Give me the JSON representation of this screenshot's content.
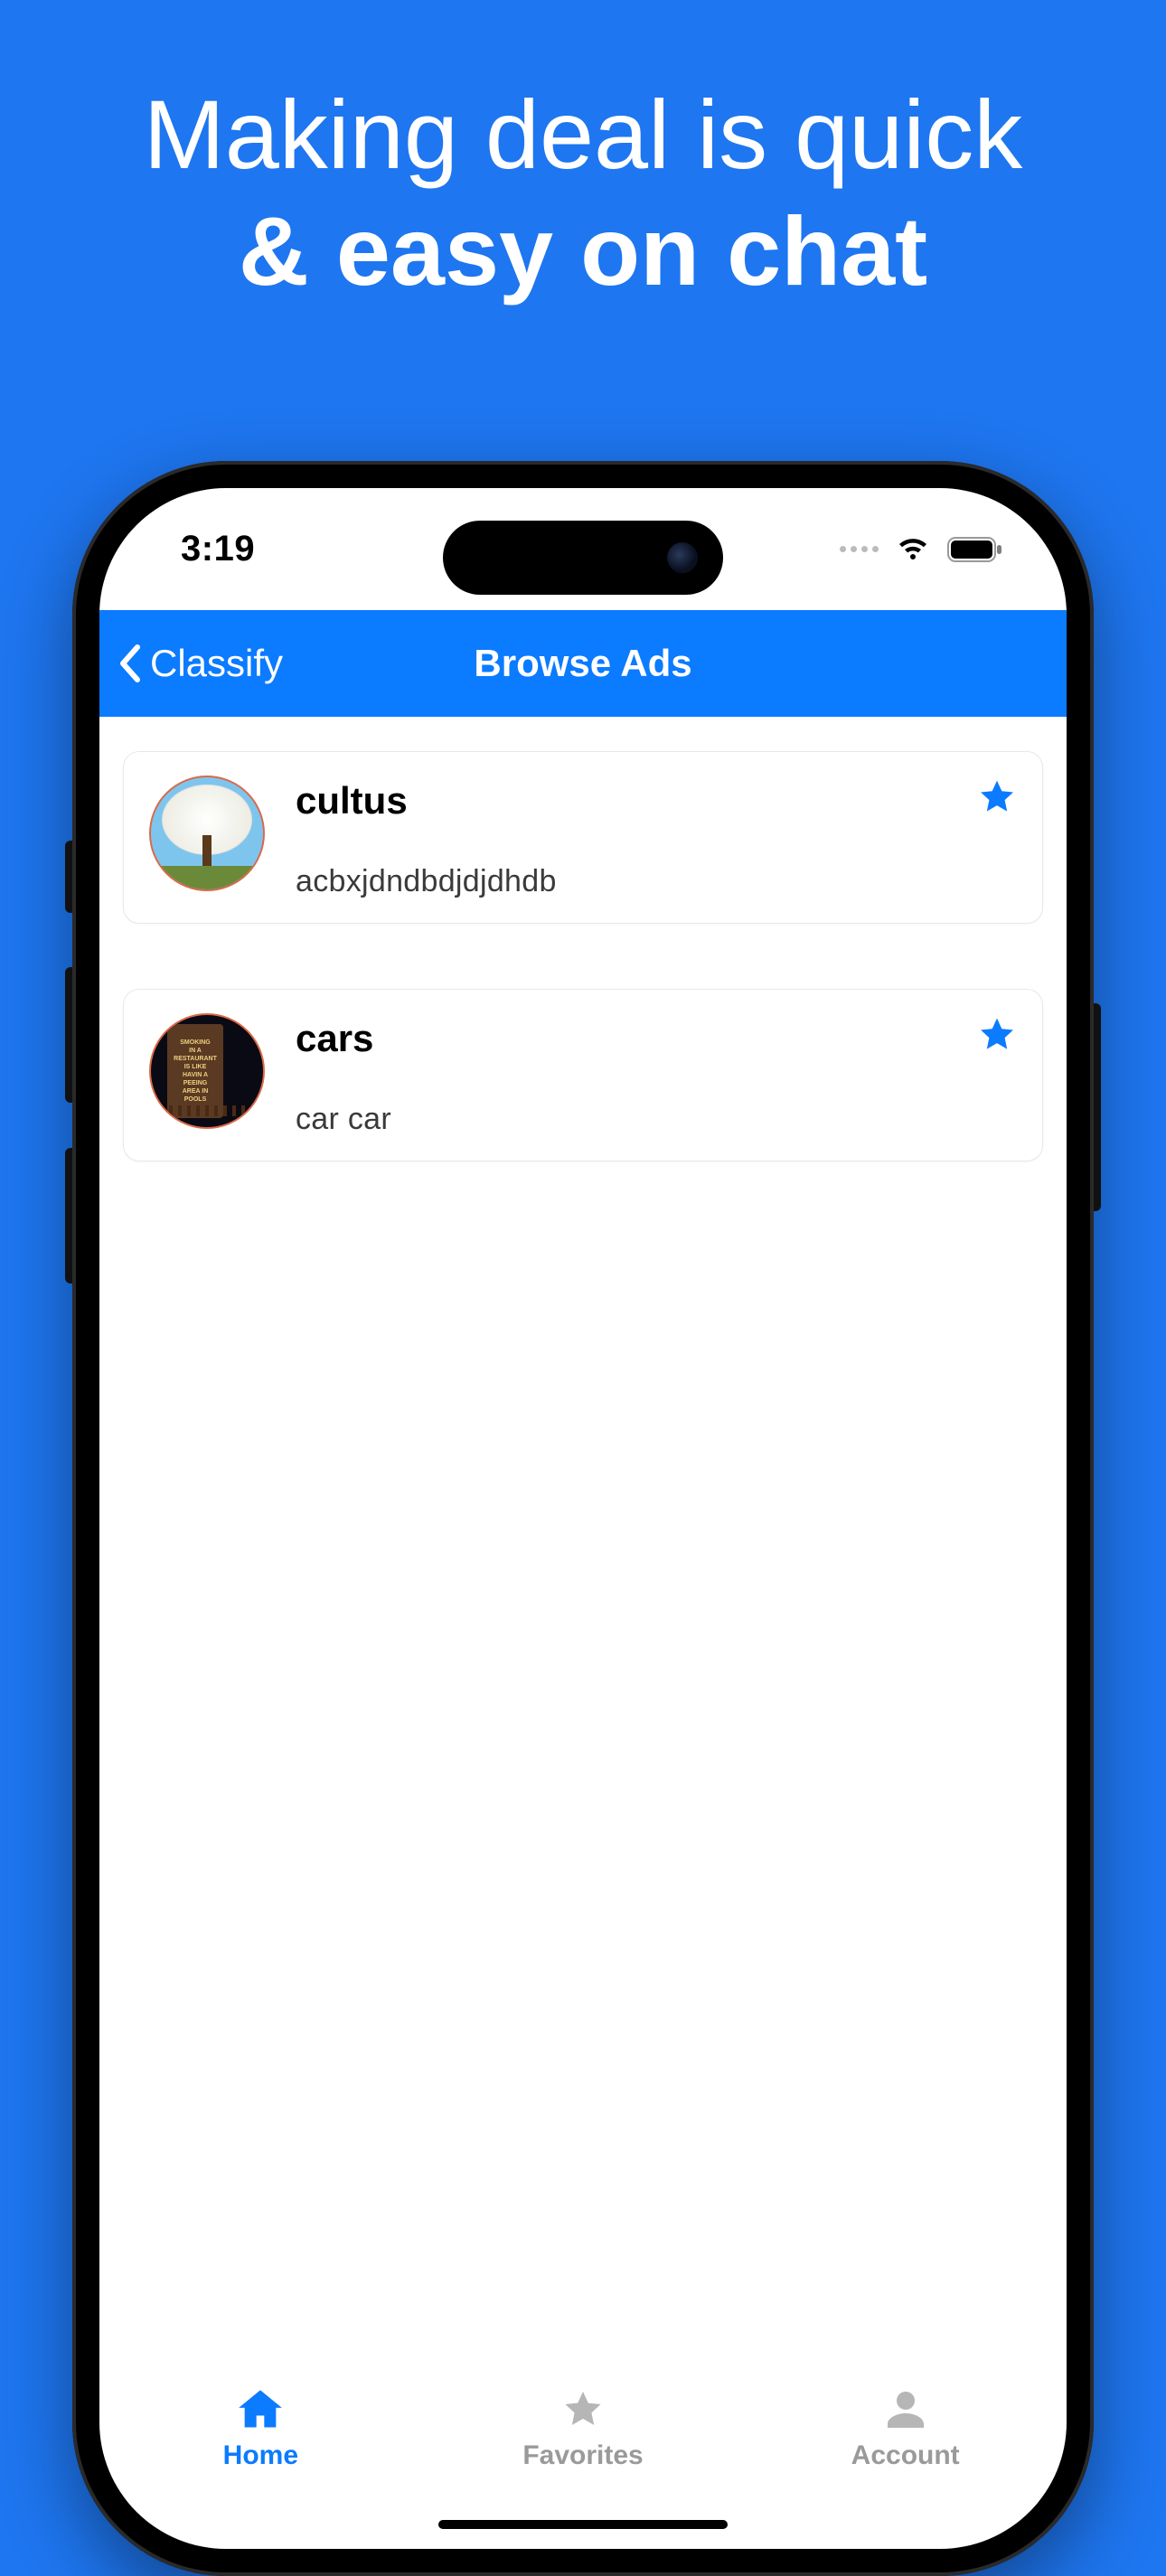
{
  "promo": {
    "line1": "Making deal is quick",
    "line2": "& easy on chat"
  },
  "status": {
    "time": "3:19"
  },
  "nav": {
    "back_label": "Classify",
    "title": "Browse Ads"
  },
  "ads": [
    {
      "title": "cultus",
      "desc": "acbxjdndbdjdjdhdb"
    },
    {
      "title": "cars",
      "desc": "car car"
    }
  ],
  "tabs": {
    "home": "Home",
    "favorites": "Favorites",
    "account": "Account"
  },
  "colors": {
    "accent": "#0b7bff",
    "bg": "#1e76f0"
  }
}
